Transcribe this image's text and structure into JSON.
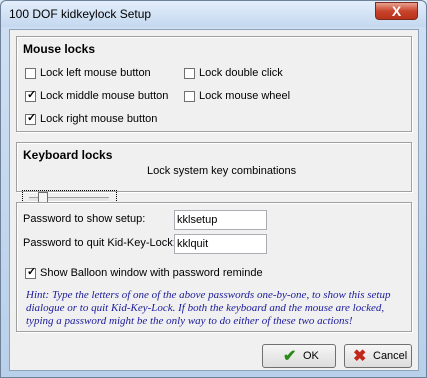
{
  "window": {
    "title": "100 DOF kidkeylock Setup",
    "close_glyph": "X"
  },
  "mouse_locks": {
    "title": "Mouse locks",
    "items": [
      {
        "label": "Lock left mouse button",
        "checked": false
      },
      {
        "label": "Lock double click",
        "checked": false
      },
      {
        "label": "Lock middle mouse button",
        "checked": true
      },
      {
        "label": "Lock mouse wheel",
        "checked": false
      },
      {
        "label": "Lock right mouse button",
        "checked": true
      }
    ]
  },
  "keyboard_locks": {
    "title": "Keyboard locks",
    "level_label": "Lock system key combinations",
    "slider_position": 1,
    "slider_steps": 5
  },
  "passwords": {
    "setup_label": "Password to show setup:",
    "setup_value": "kklsetup",
    "quit_label": "Password to quit Kid-Key-Lock:",
    "quit_value": "kklquit",
    "balloon_label": "Show Balloon window with password reminde",
    "balloon_checked": true,
    "hint": "Hint: Type the letters of one of the above passwords one-by-one, to show this setup dialogue or to quit Kid-Key-Lock. If both the keyboard and the mouse are locked, typing a password might be the only way to do either of these two actions!"
  },
  "buttons": {
    "ok_label": "OK",
    "cancel_label": "Cancel",
    "ok_icon": "checkmark-icon",
    "cancel_icon": "x-mark-icon"
  },
  "colors": {
    "hint": "#1a1a9c",
    "ok_icon": "#2a8a1a",
    "cancel_icon": "#c0281c"
  }
}
